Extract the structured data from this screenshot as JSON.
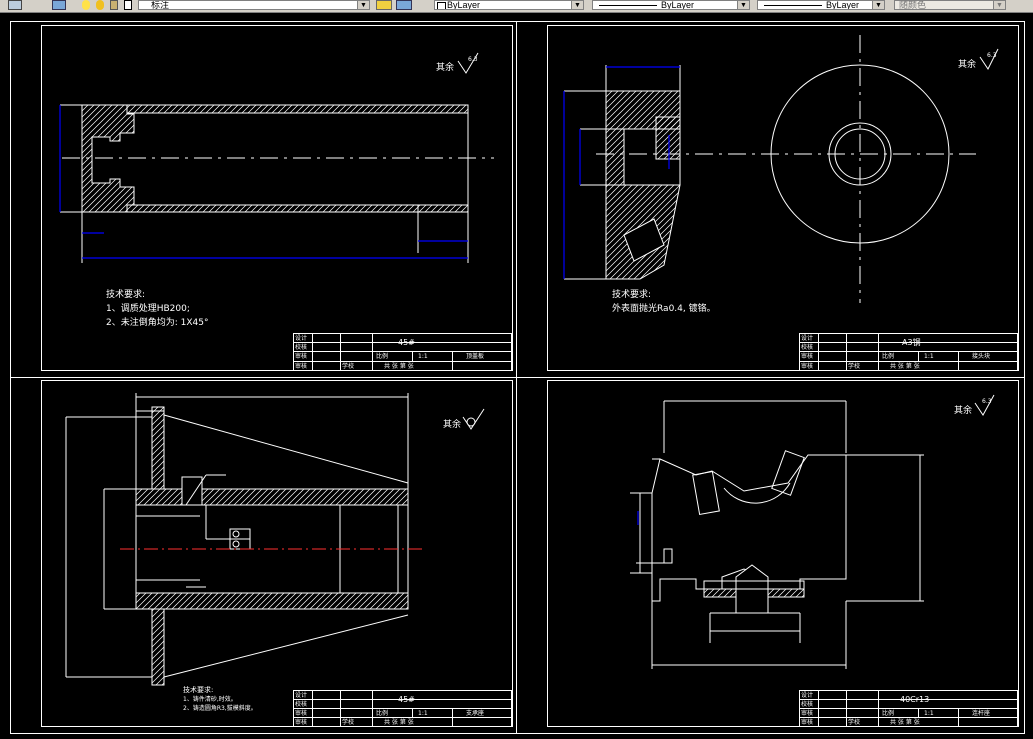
{
  "toolbar": {
    "layer_name": "标注",
    "linetype": "ByLayer",
    "lineweight": "ByLayer",
    "plotstyle": "ByLayer",
    "color": "随颜色"
  },
  "sheets": [
    {
      "roughness_label": "其余",
      "roughness_value": "6.3",
      "notes_title": "技术要求:",
      "notes": [
        "1、调质处理HB200;",
        "2、未注倒角均为: 1X45°"
      ],
      "material": "45#",
      "scale": "1:1",
      "part_name": "顶盖板",
      "tb": {
        "design": "设计",
        "check": "校核",
        "audit": "审核",
        "ratio": "比例",
        "school": "学校",
        "sheet": "共 张 第 张"
      }
    },
    {
      "roughness_label": "其余",
      "roughness_value": "6.3",
      "notes_title": "技术要求:",
      "notes": [
        "外表面抛光Ra0.4, 镀铬。"
      ],
      "material": "A3钢",
      "scale": "1:1",
      "part_name": "接头块",
      "tb": {
        "design": "设计",
        "check": "校核",
        "audit": "审核",
        "ratio": "比例",
        "school": "学校",
        "sheet": "共 张 第 张"
      }
    },
    {
      "roughness_label": "其余",
      "roughness_value": "",
      "notes_title": "技术要求:",
      "notes": [
        "1、铸件清砂,时效。",
        "2、铸造圆角R3,拔模斜度。"
      ],
      "material": "45#",
      "scale": "1:1",
      "part_name": "支承座",
      "tb": {
        "design": "设计",
        "check": "校核",
        "audit": "审核",
        "ratio": "比例",
        "school": "学校",
        "sheet": "共 张 第 张"
      }
    },
    {
      "roughness_label": "其余",
      "roughness_value": "6.3",
      "notes_title": "",
      "notes": [],
      "material": "40Cr13",
      "scale": "1:1",
      "part_name": "连杆座",
      "tb": {
        "design": "设计",
        "check": "校核",
        "audit": "审核",
        "ratio": "比例",
        "school": "学校",
        "sheet": "共 张 第 张"
      }
    }
  ]
}
